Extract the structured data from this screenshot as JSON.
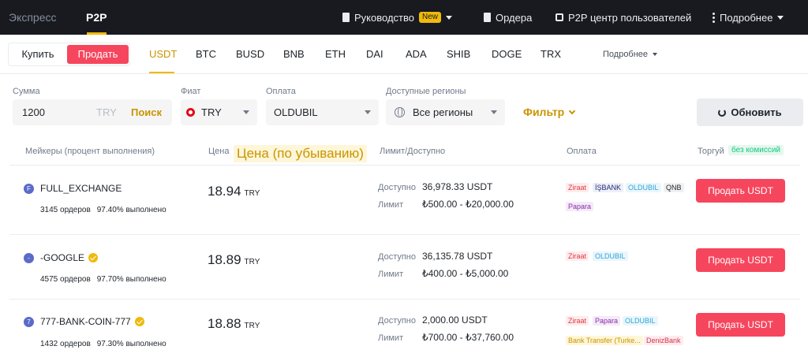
{
  "topnav": {
    "express": "Экспресс",
    "p2p": "P2P",
    "guide": "Руководство",
    "guide_badge": "New",
    "orders": "Ордера",
    "user_center": "P2P центр пользователей",
    "more": "Подробнее"
  },
  "trade": {
    "buy": "Купить",
    "sell": "Продать"
  },
  "assets": [
    "USDT",
    "BTC",
    "BUSD",
    "BNB",
    "ETH",
    "DAI",
    "ADA",
    "SHIB",
    "DOGE",
    "TRX"
  ],
  "assets_more": "Подробнее",
  "filters": {
    "amount_label": "Сумма",
    "amount_value": "1200",
    "amount_currency": "TRY",
    "search": "Поиск",
    "fiat_label": "Фиат",
    "fiat_value": "TRY",
    "payment_label": "Оплата",
    "payment_value": "OLDUBIL",
    "region_label": "Доступные регионы",
    "region_value": "Все регионы",
    "filter": "Фильтр",
    "refresh": "Обновить"
  },
  "table_header": {
    "makers": "Мейкеры (процент выполнения)",
    "price": "Цена",
    "price_tag": "Цена (по убыванию)",
    "limit": "Лимит/Доступно",
    "payment": "Оплата",
    "trade": "Торгуй",
    "fee_tag": "без комиссий"
  },
  "labels": {
    "available": "Доступно",
    "limit": "Лимит",
    "currency": "TRY",
    "sell_button": "Продать USDT"
  },
  "rows": [
    {
      "avatar": "F",
      "name": "FULL_EXCHANGE",
      "verified": false,
      "orders": "3145 ордеров",
      "completion": "97.40% выполнено",
      "price": "18.94",
      "available": "36,978.33 USDT",
      "limit": "₺500.00 - ₺20,000.00",
      "payments": [
        "Ziraat",
        "İŞBANK",
        "OLDUBIL",
        "QNB",
        "Papara"
      ]
    },
    {
      "avatar": "-",
      "name": "-GOOGLE",
      "verified": true,
      "orders": "4575 ордеров",
      "completion": "97.70% выполнено",
      "price": "18.89",
      "available": "36,135.78 USDT",
      "limit": "₺400.00 - ₺5,000.00",
      "payments": [
        "Ziraat",
        "OLDUBIL"
      ]
    },
    {
      "avatar": "7",
      "name": "777-BANK-COIN-777",
      "verified": true,
      "orders": "1432 ордеров",
      "completion": "97.30% выполнено",
      "price": "18.88",
      "available": "2,000.00 USDT",
      "limit": "₺700.00 - ₺37,760.00",
      "payments": [
        "Ziraat",
        "Papara",
        "OLDUBIL",
        "Bank Transfer (Turke...",
        "DenizBank"
      ]
    }
  ],
  "colors": {
    "accent": "#f0b90b",
    "sell": "#f6465d",
    "nav_bg": "#181a20",
    "Ziraat": "#e0393e",
    "İŞBANK": "#1e2a78",
    "OLDUBIL": "#2fa5d8",
    "QNB": "#1e2329",
    "Papara": "#8a2ea8",
    "Bank Transfer (Turke...": "#f0b90b",
    "DenizBank": "#d9304f"
  }
}
